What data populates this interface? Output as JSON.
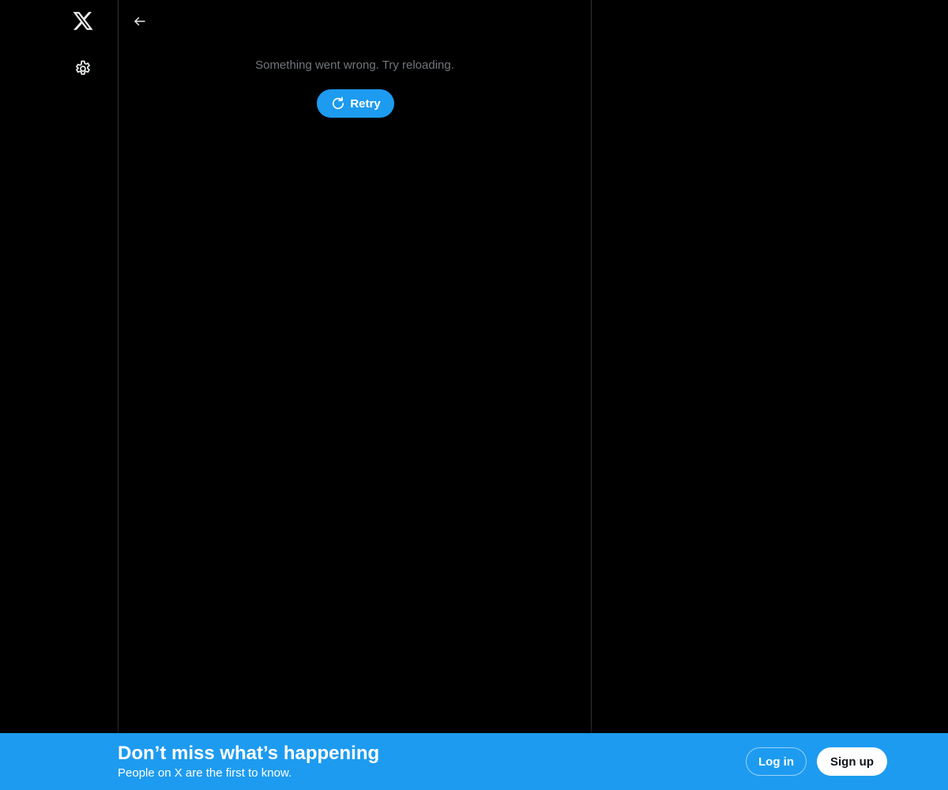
{
  "nav": {
    "logo_icon": "x-logo-icon",
    "settings_icon": "gear-icon"
  },
  "main": {
    "back_icon": "arrow-left-icon",
    "error_message": "Something went wrong. Try reloading.",
    "retry_label": "Retry",
    "retry_icon": "refresh-icon"
  },
  "bottom_bar": {
    "title": "Don’t miss what’s happening",
    "subtitle": "People on X are the first to know.",
    "login_label": "Log in",
    "signup_label": "Sign up"
  },
  "colors": {
    "background": "#000000",
    "accent": "#1d9bf0",
    "muted_text": "#71767b",
    "border": "#2f3336"
  }
}
